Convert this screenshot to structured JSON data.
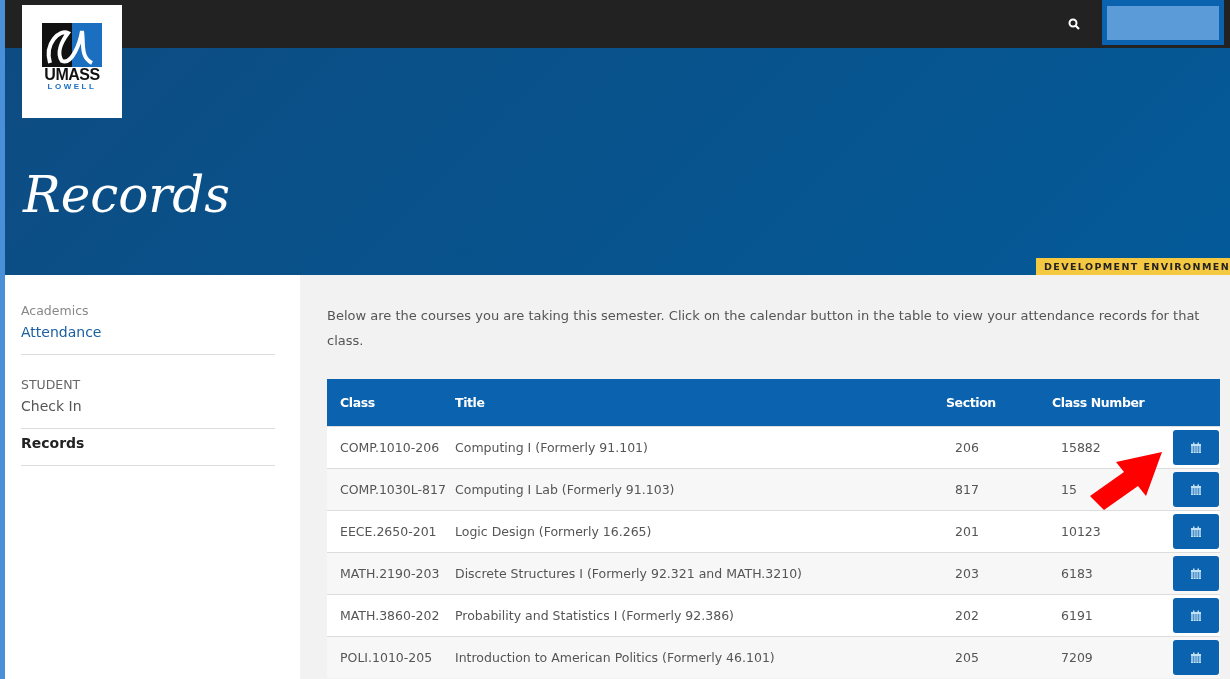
{
  "logo": {
    "line_1": "UMASS",
    "line_2": "LOWELL"
  },
  "header": {
    "title": "Records",
    "environment_badge": "DEVELOPMENT ENVIRONMEN"
  },
  "sidebar": {
    "sections": [
      {
        "heading": "Academics",
        "items": [
          {
            "label": "Attendance",
            "selected": false
          }
        ]
      },
      {
        "heading": "STUDENT",
        "items": [
          {
            "label": "Check In",
            "selected": false
          },
          {
            "label": "Records",
            "selected": true
          }
        ]
      }
    ]
  },
  "intro": "Below are the courses you are taking this semester. Click on the calendar button in the table to view your attendance records for that class.",
  "table": {
    "columns": [
      "Class",
      "Title",
      "Section",
      "Class Number"
    ],
    "rows": [
      {
        "class": "COMP.1010-206",
        "title": "Computing I (Formerly 91.101)",
        "section": "206",
        "class_number": "15882"
      },
      {
        "class": "COMP.1030L-817",
        "title": "Computing I Lab (Formerly 91.103)",
        "section": "817",
        "class_number": "15"
      },
      {
        "class": "EECE.2650-201",
        "title": "Logic Design (Formerly 16.265)",
        "section": "201",
        "class_number": "10123"
      },
      {
        "class": "MATH.2190-203",
        "title": "Discrete Structures I (Formerly 92.321 and MATH.3210)",
        "section": "203",
        "class_number": "6183"
      },
      {
        "class": "MATH.3860-202",
        "title": "Probability and Statistics I (Formerly 92.386)",
        "section": "202",
        "class_number": "6191"
      },
      {
        "class": "POLI.1010-205",
        "title": "Introduction to American Politics (Formerly 46.101)",
        "section": "205",
        "class_number": "7209"
      }
    ]
  }
}
